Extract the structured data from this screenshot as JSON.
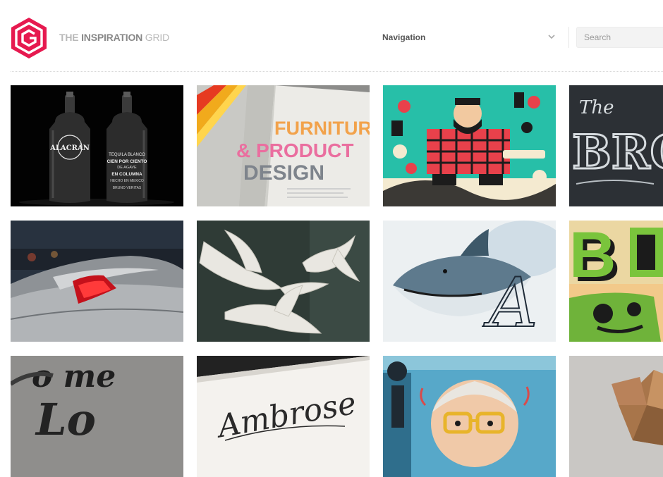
{
  "brand": {
    "the": "THE ",
    "inspiration": "INSPIRATION",
    "grid": " GRID"
  },
  "header": {
    "navigation_label": "Navigation",
    "search_placeholder": "Search"
  },
  "tiles": [
    {
      "name": "alacran-tequila-bottles",
      "texts": [
        "ALACRÁN",
        "TEQUILA BLANCO",
        "CIEN POR CIENTO",
        "DE AGAVE",
        "EN COLUMNA",
        "HECHO EN MEXICO",
        "BRUNO VERITAS"
      ]
    },
    {
      "name": "furniture-product-design-magazine",
      "texts": [
        "FURNITUR",
        "& PRODUCT",
        "DESIGN"
      ]
    },
    {
      "name": "lumberjack-illustration",
      "texts": []
    },
    {
      "name": "chalkboard-lettering",
      "texts": [
        "The",
        "BRO"
      ]
    },
    {
      "name": "concept-car-tail-light",
      "texts": []
    },
    {
      "name": "paper-cut-doves",
      "texts": []
    },
    {
      "name": "shark-typography",
      "texts": [
        "A"
      ]
    },
    {
      "name": "green-block-lettering",
      "texts": [
        "B"
      ]
    },
    {
      "name": "script-lettering-sculpture",
      "texts": [
        "o me",
        "Lo"
      ]
    },
    {
      "name": "ambrose-calligraphy-card",
      "texts": [
        "Ambrose"
      ]
    },
    {
      "name": "old-man-glasses-illustration",
      "texts": []
    },
    {
      "name": "wooden-sculpture",
      "texts": []
    }
  ],
  "colors": {
    "accent": "#e6194f",
    "text_gray": "#888888"
  }
}
